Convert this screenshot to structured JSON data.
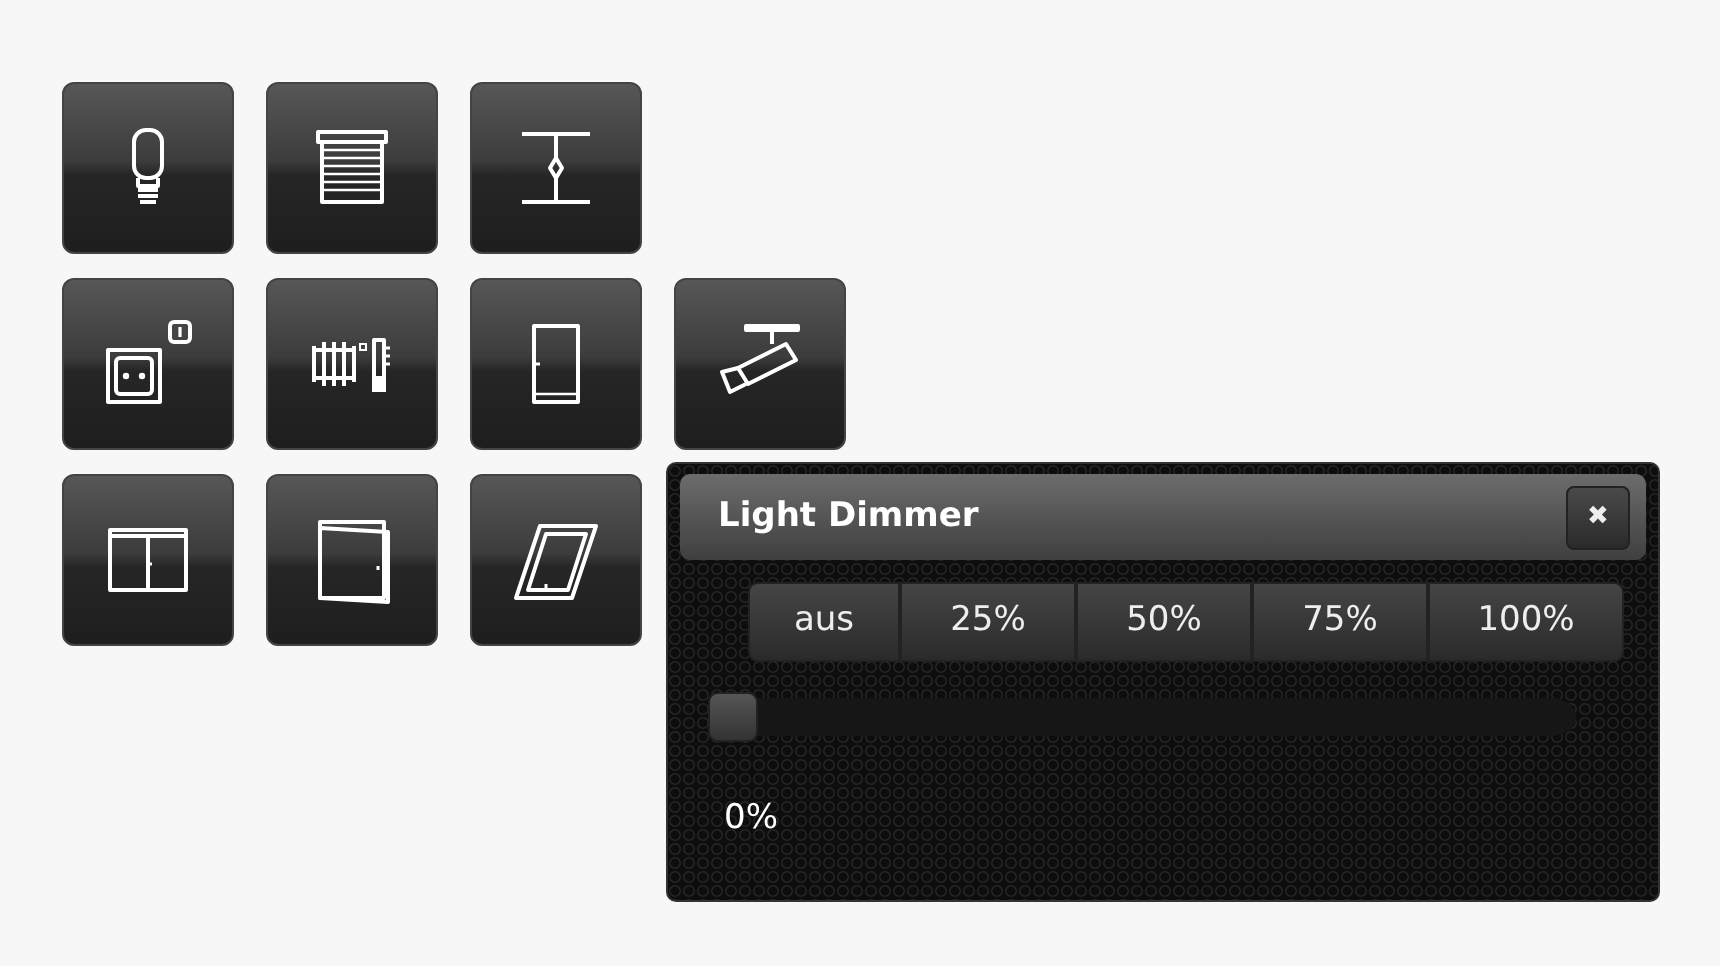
{
  "tile_rows": [
    [
      {
        "kind": "bulb"
      },
      {
        "kind": "shutter"
      },
      {
        "kind": "gate"
      }
    ],
    [
      {
        "kind": "socket"
      },
      {
        "kind": "radiator"
      },
      {
        "kind": "door"
      },
      {
        "kind": "camera"
      }
    ],
    [
      {
        "kind": "window"
      },
      {
        "kind": "door_open"
      },
      {
        "kind": "skylight"
      }
    ]
  ],
  "dialog": {
    "title": "Light Dimmer",
    "close": "✖",
    "presets": [
      "aus",
      "25%",
      "50%",
      "75%",
      "100%"
    ],
    "slider": {
      "level": 0,
      "reading": "0%"
    }
  }
}
